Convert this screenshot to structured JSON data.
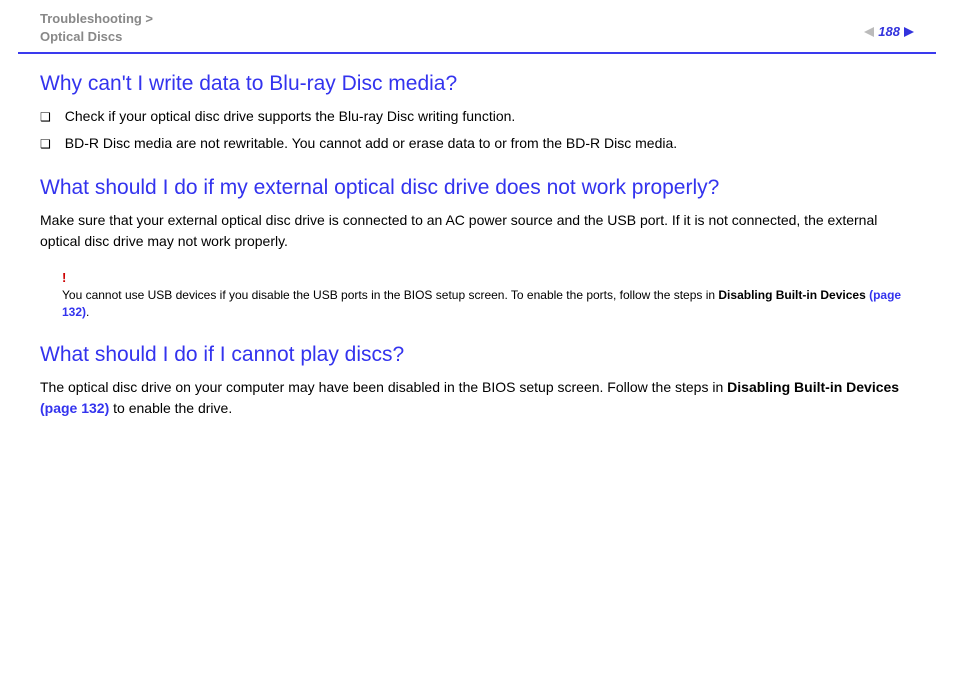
{
  "header": {
    "breadcrumb_line1": "Troubleshooting >",
    "breadcrumb_line2": "Optical Discs",
    "page_number": "188"
  },
  "sections": {
    "bluray": {
      "heading": "Why can't I write data to Blu-ray Disc media?",
      "bullets": [
        "Check if your optical disc drive supports the Blu-ray Disc writing function.",
        "BD-R Disc media are not rewritable. You cannot add or erase data to or from the BD-R Disc media."
      ]
    },
    "external_drive": {
      "heading": "What should I do if my external optical disc drive does not work properly?",
      "body": "Make sure that your external optical disc drive is connected to an AC power source and the USB port. If it is not connected, the external optical disc drive may not work properly.",
      "note_marker": "!",
      "note_prefix": "You cannot use USB devices if you disable the USB ports in the BIOS setup screen. To enable the ports, follow the steps in ",
      "note_link_bold": "Disabling Built-in Devices ",
      "note_link_page": "(page 132)",
      "note_suffix": "."
    },
    "cannot_play": {
      "heading": "What should I do if I cannot play discs?",
      "body_prefix": "The optical disc drive on your computer may have been disabled in the BIOS setup screen. Follow the steps in ",
      "body_link_bold": "Disabling Built-in Devices ",
      "body_link_page": "(page 132)",
      "body_suffix": " to enable the drive."
    }
  }
}
